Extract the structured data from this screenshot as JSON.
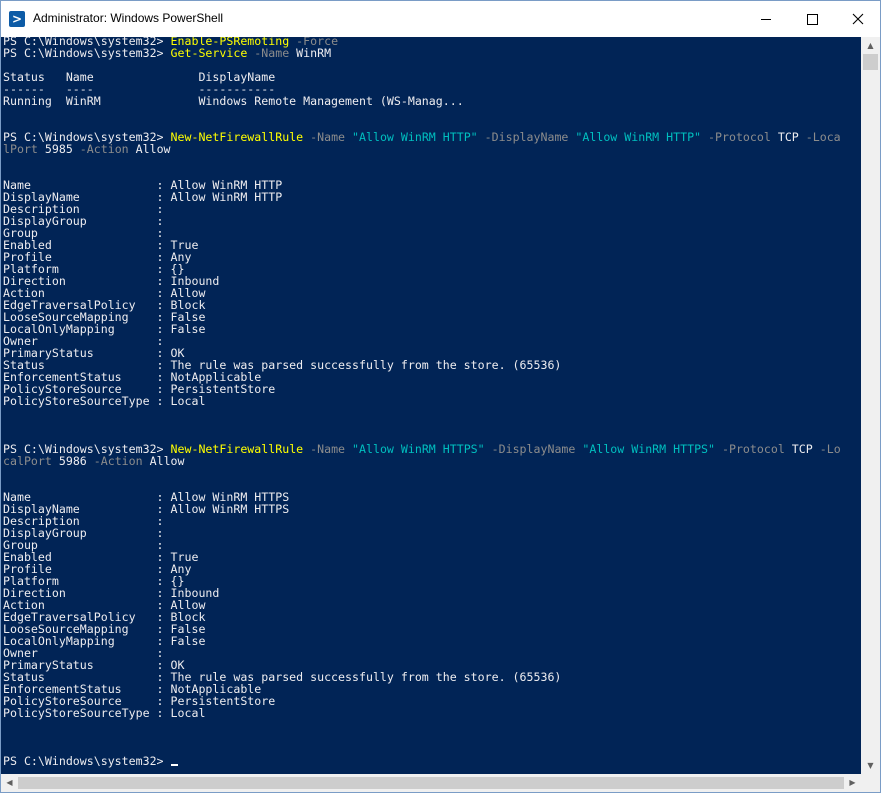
{
  "window": {
    "title": "Administrator: Windows PowerShell",
    "icon": "powershell-icon"
  },
  "titlebar_buttons": {
    "minimize": "minimize-icon",
    "maximize": "maximize-icon",
    "close": "close-icon"
  },
  "colors": {
    "background": "#012456",
    "command": "#ffff00",
    "parameter": "#8c8c8c",
    "string": "#00bfbf",
    "text": "#eeedf0"
  },
  "console_lines": [
    [
      {
        "t": "PS C:\\Windows\\system32> ",
        "c": ""
      },
      {
        "t": "Enable-PSRemoting",
        "c": "cmd"
      },
      {
        "t": " -Force",
        "c": "par"
      }
    ],
    [
      {
        "t": "PS C:\\Windows\\system32> ",
        "c": ""
      },
      {
        "t": "Get-Service",
        "c": "cmd"
      },
      {
        "t": " -Name",
        "c": "par"
      },
      {
        "t": " WinRM",
        "c": ""
      }
    ],
    [],
    [
      {
        "t": "Status   Name               DisplayName",
        "c": ""
      }
    ],
    [
      {
        "t": "------   ----               -----------",
        "c": ""
      }
    ],
    [
      {
        "t": "Running  WinRM              Windows Remote Management (WS-Manag...",
        "c": ""
      }
    ],
    [],
    [],
    [
      {
        "t": "PS C:\\Windows\\system32> ",
        "c": ""
      },
      {
        "t": "New-NetFirewallRule",
        "c": "cmd"
      },
      {
        "t": " -Name",
        "c": "par"
      },
      {
        "t": " \"Allow WinRM HTTP\"",
        "c": "str"
      },
      {
        "t": " -DisplayName",
        "c": "par"
      },
      {
        "t": " \"Allow WinRM HTTP\"",
        "c": "str"
      },
      {
        "t": " -Protocol",
        "c": "par"
      },
      {
        "t": " TCP",
        "c": ""
      },
      {
        "t": " -Loca",
        "c": "par"
      }
    ],
    [
      {
        "t": "lPort",
        "c": "par"
      },
      {
        "t": " 5985",
        "c": ""
      },
      {
        "t": " -Action",
        "c": "par"
      },
      {
        "t": " Allow",
        "c": ""
      }
    ],
    [],
    [],
    [
      {
        "t": "Name                  : Allow WinRM HTTP",
        "c": ""
      }
    ],
    [
      {
        "t": "DisplayName           : Allow WinRM HTTP",
        "c": ""
      }
    ],
    [
      {
        "t": "Description           :",
        "c": ""
      }
    ],
    [
      {
        "t": "DisplayGroup          :",
        "c": ""
      }
    ],
    [
      {
        "t": "Group                 :",
        "c": ""
      }
    ],
    [
      {
        "t": "Enabled               : True",
        "c": ""
      }
    ],
    [
      {
        "t": "Profile               : Any",
        "c": ""
      }
    ],
    [
      {
        "t": "Platform              : {}",
        "c": ""
      }
    ],
    [
      {
        "t": "Direction             : Inbound",
        "c": ""
      }
    ],
    [
      {
        "t": "Action                : Allow",
        "c": ""
      }
    ],
    [
      {
        "t": "EdgeTraversalPolicy   : Block",
        "c": ""
      }
    ],
    [
      {
        "t": "LooseSourceMapping    : False",
        "c": ""
      }
    ],
    [
      {
        "t": "LocalOnlyMapping      : False",
        "c": ""
      }
    ],
    [
      {
        "t": "Owner                 :",
        "c": ""
      }
    ],
    [
      {
        "t": "PrimaryStatus         : OK",
        "c": ""
      }
    ],
    [
      {
        "t": "Status                : The rule was parsed successfully from the store. (65536)",
        "c": ""
      }
    ],
    [
      {
        "t": "EnforcementStatus     : NotApplicable",
        "c": ""
      }
    ],
    [
      {
        "t": "PolicyStoreSource     : PersistentStore",
        "c": ""
      }
    ],
    [
      {
        "t": "PolicyStoreSourceType : Local",
        "c": ""
      }
    ],
    [],
    [],
    [],
    [
      {
        "t": "PS C:\\Windows\\system32> ",
        "c": ""
      },
      {
        "t": "New-NetFirewallRule",
        "c": "cmd"
      },
      {
        "t": " -Name",
        "c": "par"
      },
      {
        "t": " \"Allow WinRM HTTPS\"",
        "c": "str"
      },
      {
        "t": " -DisplayName",
        "c": "par"
      },
      {
        "t": " \"Allow WinRM HTTPS\"",
        "c": "str"
      },
      {
        "t": " -Protocol",
        "c": "par"
      },
      {
        "t": " TCP",
        "c": ""
      },
      {
        "t": " -Lo",
        "c": "par"
      }
    ],
    [
      {
        "t": "calPort",
        "c": "par"
      },
      {
        "t": " 5986",
        "c": ""
      },
      {
        "t": " -Action",
        "c": "par"
      },
      {
        "t": " Allow",
        "c": ""
      }
    ],
    [],
    [],
    [
      {
        "t": "Name                  : Allow WinRM HTTPS",
        "c": ""
      }
    ],
    [
      {
        "t": "DisplayName           : Allow WinRM HTTPS",
        "c": ""
      }
    ],
    [
      {
        "t": "Description           :",
        "c": ""
      }
    ],
    [
      {
        "t": "DisplayGroup          :",
        "c": ""
      }
    ],
    [
      {
        "t": "Group                 :",
        "c": ""
      }
    ],
    [
      {
        "t": "Enabled               : True",
        "c": ""
      }
    ],
    [
      {
        "t": "Profile               : Any",
        "c": ""
      }
    ],
    [
      {
        "t": "Platform              : {}",
        "c": ""
      }
    ],
    [
      {
        "t": "Direction             : Inbound",
        "c": ""
      }
    ],
    [
      {
        "t": "Action                : Allow",
        "c": ""
      }
    ],
    [
      {
        "t": "EdgeTraversalPolicy   : Block",
        "c": ""
      }
    ],
    [
      {
        "t": "LooseSourceMapping    : False",
        "c": ""
      }
    ],
    [
      {
        "t": "LocalOnlyMapping      : False",
        "c": ""
      }
    ],
    [
      {
        "t": "Owner                 :",
        "c": ""
      }
    ],
    [
      {
        "t": "PrimaryStatus         : OK",
        "c": ""
      }
    ],
    [
      {
        "t": "Status                : The rule was parsed successfully from the store. (65536)",
        "c": ""
      }
    ],
    [
      {
        "t": "EnforcementStatus     : NotApplicable",
        "c": ""
      }
    ],
    [
      {
        "t": "PolicyStoreSource     : PersistentStore",
        "c": ""
      }
    ],
    [
      {
        "t": "PolicyStoreSourceType : Local",
        "c": ""
      }
    ],
    [],
    [],
    [],
    [
      {
        "t": "PS C:\\Windows\\system32> ",
        "c": ""
      }
    ]
  ]
}
